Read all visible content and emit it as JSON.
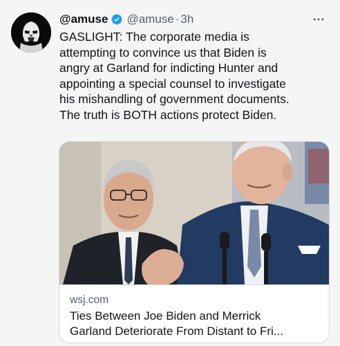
{
  "tweet": {
    "display_name": "@amuse",
    "handle": "@amuse",
    "separator": "·",
    "time": "3h",
    "more_icon": "more-horizontal-icon",
    "text": "GASLIGHT: The corporate media is\nattempting to convince us that Biden is\nangry at Garland for indicting Hunter and\nappointing a special counsel to investigate\nhis mishandling of government documents.\nThe truth is BOTH actions protect Biden."
  },
  "card": {
    "domain": "wsj.com",
    "title_line1": "Ties Between Joe Biden and Merrick",
    "title_line2": "Garland Deteriorate From Distant to Fri..."
  },
  "colors": {
    "verified_blue": "#1d9bf0",
    "secondary_text": "#536471",
    "border": "#cfd9de"
  }
}
